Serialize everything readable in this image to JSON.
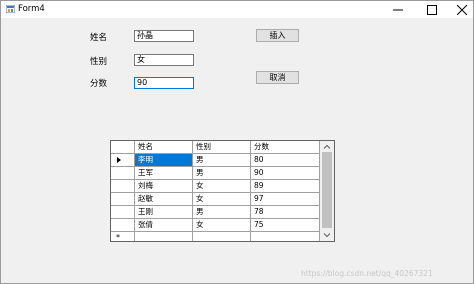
{
  "window": {
    "title": "Form4",
    "controls": [
      "minimize-icon",
      "maximize-icon",
      "close-icon"
    ]
  },
  "form": {
    "name_label": "姓名",
    "name_value": "孙晶",
    "gender_label": "性别",
    "gender_value": "女",
    "score_label": "分数",
    "score_value": "90",
    "insert_button": "插入",
    "cancel_button": "取消"
  },
  "grid": {
    "columns": [
      "",
      "姓名",
      "性别",
      "分数"
    ],
    "rows": [
      {
        "name": "李明",
        "gender": "男",
        "score": "80",
        "current": true
      },
      {
        "name": "王军",
        "gender": "男",
        "score": "90"
      },
      {
        "name": "刘梅",
        "gender": "女",
        "score": "89"
      },
      {
        "name": "赵敏",
        "gender": "女",
        "score": "97"
      },
      {
        "name": "王刚",
        "gender": "男",
        "score": "78"
      },
      {
        "name": "张倩",
        "gender": "女",
        "score": "75"
      }
    ],
    "new_row_marker": "*",
    "selected_color": "#0078d7"
  },
  "watermark": "https://blog.csdn.net/qq_40267321"
}
